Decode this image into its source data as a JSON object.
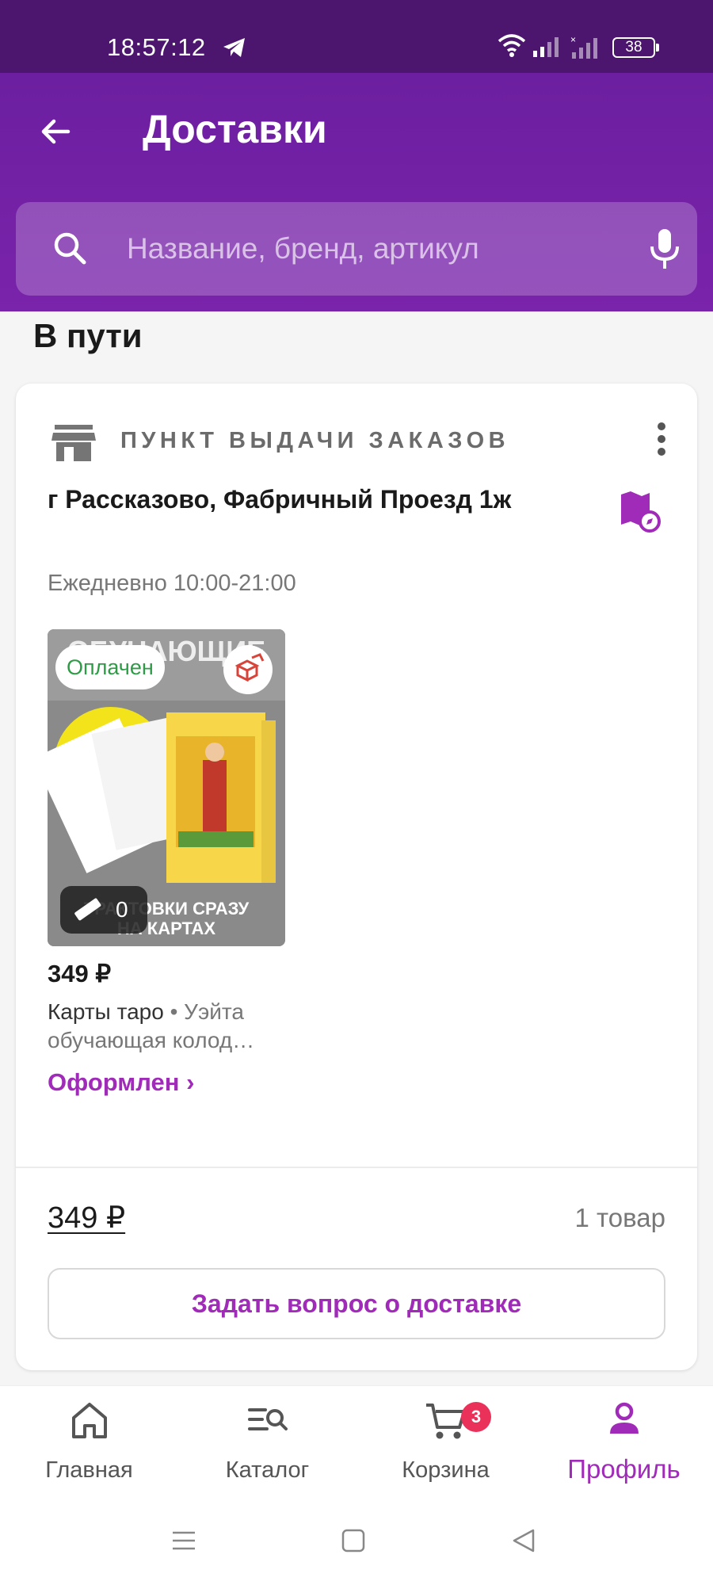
{
  "status_bar": {
    "time": "18:57:12",
    "battery": "38"
  },
  "header": {
    "title": "Доставки"
  },
  "search": {
    "placeholder": "Название, бренд, артикул"
  },
  "section": {
    "title": "В пути"
  },
  "delivery": {
    "pickup_label": "ПУНКТ ВЫДАЧИ ЗАКАЗОВ",
    "address": "г Рассказово, Фабричный Проезд 1ж",
    "hours": "Ежедневно 10:00-21:00",
    "product": {
      "badge": "Оплачен",
      "measure_count": "0",
      "price": "349 ₽",
      "name": "Карты таро",
      "brand_sep": " • ",
      "brand": "Уэйта обучающая колод…",
      "status": "Оформлен ›"
    },
    "total": "349 ₽",
    "count": "1 товар",
    "ask_button": "Задать вопрос о доставке"
  },
  "bottom_nav": {
    "items": [
      {
        "label": "Главная",
        "icon": "home-icon"
      },
      {
        "label": "Каталог",
        "icon": "catalog-icon"
      },
      {
        "label": "Корзина",
        "icon": "cart-icon",
        "badge": "3"
      },
      {
        "label": "Профиль",
        "icon": "profile-icon"
      }
    ],
    "active": "Профиль"
  },
  "colors": {
    "header": "#6c1fa0",
    "accent": "#a12bb9",
    "paid": "#2e9b46",
    "badge": "#e9315a"
  }
}
